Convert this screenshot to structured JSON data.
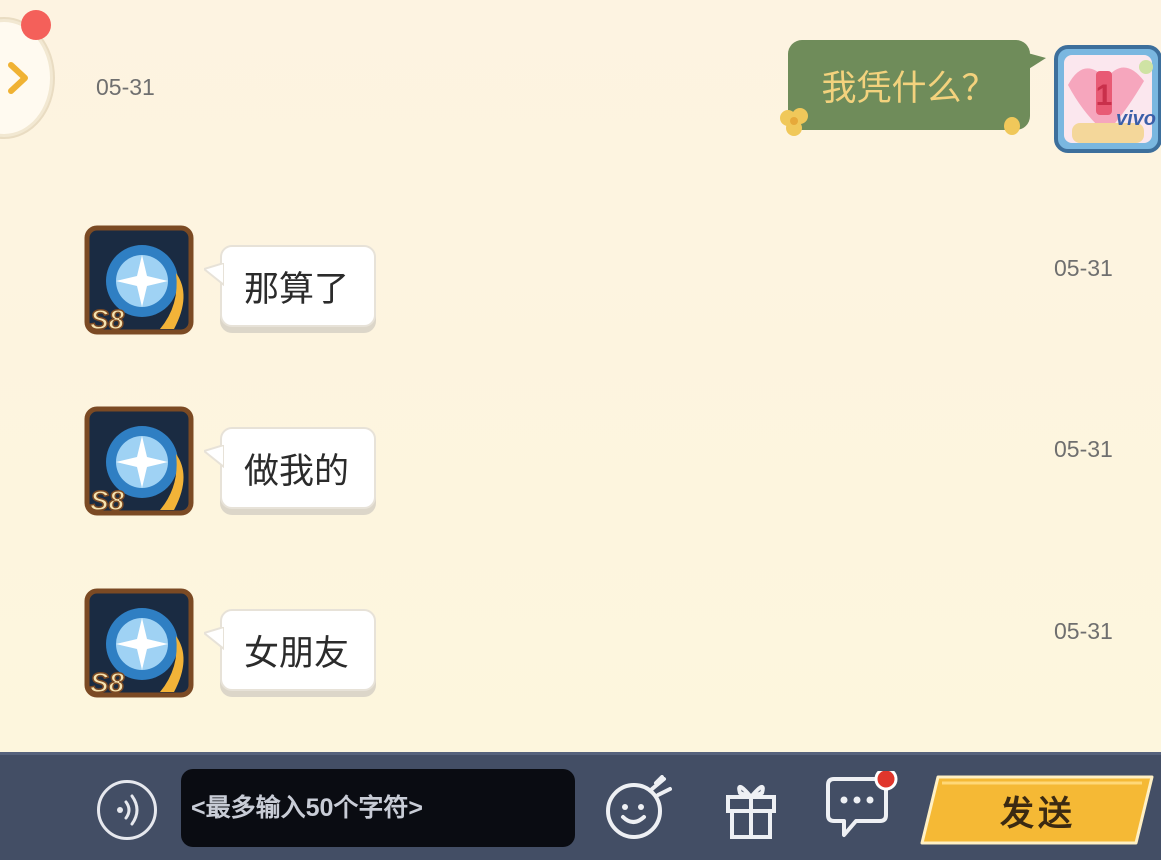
{
  "messages": [
    {
      "side": "right",
      "text": "我凭什么？",
      "time": "05-31"
    },
    {
      "side": "left",
      "text": "那算了",
      "time": "05-31"
    },
    {
      "side": "left",
      "text": "做我的",
      "time": "05-31"
    },
    {
      "side": "left",
      "text": "女朋友",
      "time": "05-31"
    }
  ],
  "avatars": {
    "self": {
      "badge": "1",
      "brand": "vivo"
    },
    "other": {
      "badge": "S8"
    }
  },
  "input": {
    "placeholder": "<最多输入50个字符>",
    "value": ""
  },
  "send_label": "发送",
  "colors": {
    "background": "#fdf5df",
    "bar": "#434e65",
    "green_bubble": "#6f8c5a",
    "send_button": "#f5b935",
    "notification_dot": "#e0362c"
  },
  "icons": [
    "chevron-right-icon",
    "voice-icon",
    "emoji-icon",
    "gift-icon",
    "chat-icon"
  ]
}
